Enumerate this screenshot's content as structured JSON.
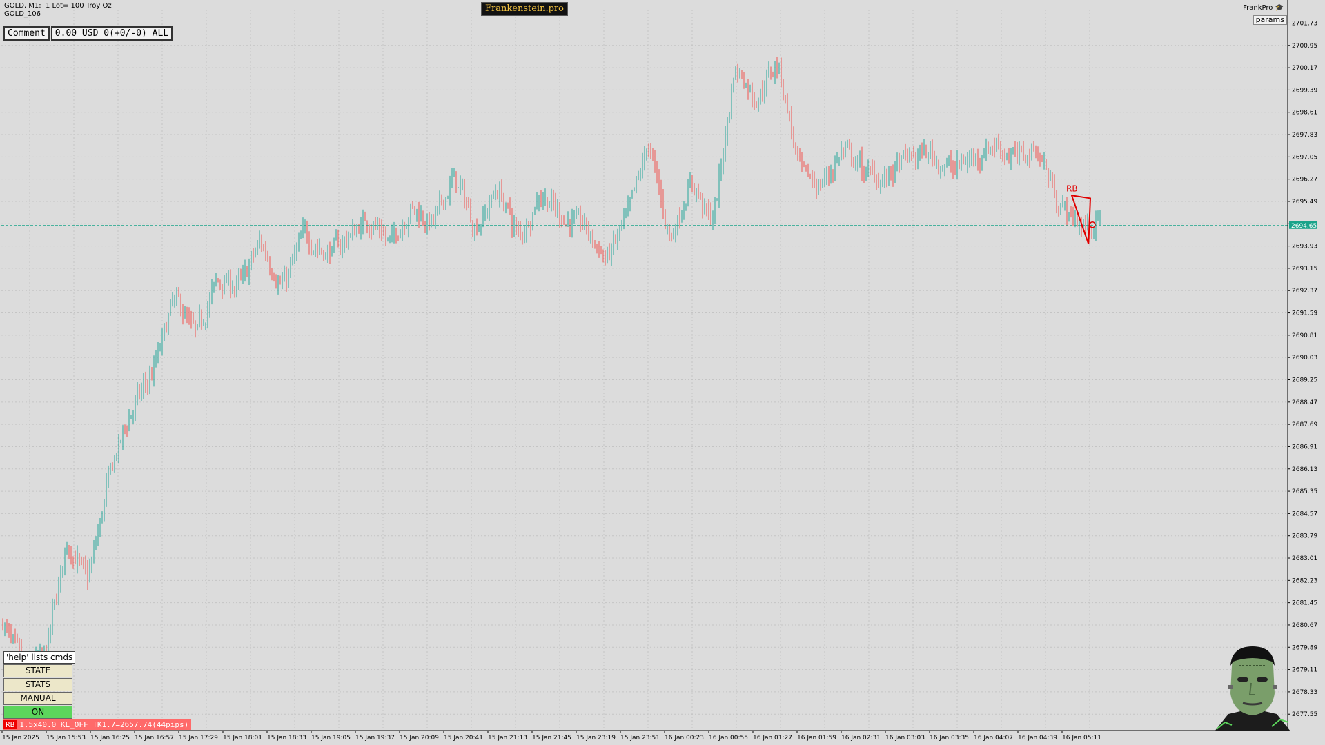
{
  "header": {
    "symbol_line": "GOLD, M1:  1 Lot= 100 Troy Oz",
    "account": "GOLD_106",
    "brand": "Frankenstein.pro",
    "right_title": "FrankPro",
    "params_label": "params"
  },
  "comment": {
    "label": "Comment",
    "value": "0.00 USD 0(+0/-0) ALL"
  },
  "controls": {
    "help": "'help' lists cmds",
    "state": "STATE",
    "stats": "STATS",
    "manual": "MANUAL",
    "on": "ON"
  },
  "status_bar": {
    "tag": "RB",
    "text": "1.5x40.0 KL_OFF TK1.7=2657.74(44pips)"
  },
  "colors": {
    "bull": "#26a69a",
    "bear": "#ef5350",
    "background": "#dcdcdc",
    "accent": "#e00000"
  },
  "chart_data": {
    "type": "candlestick",
    "ylim": [
      2677.0,
      2702.2
    ],
    "yticks": [
      "2701.73",
      "2700.95",
      "2700.17",
      "2699.39",
      "2698.61",
      "2697.83",
      "2697.05",
      "2696.27",
      "2695.49",
      "2694.71",
      "2693.93",
      "2693.15",
      "2692.37",
      "2691.59",
      "2690.81",
      "2690.03",
      "2689.25",
      "2688.47",
      "2687.69",
      "2686.91",
      "2686.13",
      "2685.35",
      "2684.57",
      "2683.79",
      "2683.01",
      "2682.23",
      "2681.45",
      "2680.67",
      "2679.89",
      "2679.11",
      "2678.33",
      "2677.55"
    ],
    "xticks": [
      "15 Jan 2025",
      "15 Jan 15:53",
      "15 Jan 16:25",
      "15 Jan 16:57",
      "15 Jan 17:29",
      "15 Jan 18:01",
      "15 Jan 18:33",
      "15 Jan 19:05",
      "15 Jan 19:37",
      "15 Jan 20:09",
      "15 Jan 20:41",
      "15 Jan 21:13",
      "15 Jan 21:45",
      "15 Jan 23:19",
      "15 Jan 23:51",
      "16 Jan 00:23",
      "16 Jan 00:55",
      "16 Jan 01:27",
      "16 Jan 01:59",
      "16 Jan 02:31",
      "16 Jan 03:03",
      "16 Jan 03:35",
      "16 Jan 04:07",
      "16 Jan 04:39",
      "16 Jan 05:11"
    ],
    "current_price": 2694.65,
    "current_price_label": "2694.65",
    "anchors": [
      2680.8,
      2679.2,
      2679.6,
      2683.6,
      2682.2,
      2686.0,
      2688.2,
      2689.5,
      2692.2,
      2690.8,
      2692.8,
      2692.5,
      2694.1,
      2692.4,
      2694.4,
      2693.6,
      2694.2,
      2694.9,
      2694.0,
      2695.3,
      2694.7,
      2696.4,
      2694.5,
      2696.0,
      2694.2,
      2695.8,
      2694.9,
      2694.7,
      2693.4,
      2694.9,
      2697.6,
      2694.1,
      2696.2,
      2694.7,
      2700.3,
      2699.0,
      2700.5,
      2696.5,
      2696.0,
      2697.3,
      2696.5,
      2696.3,
      2697.0,
      2697.2,
      2696.6,
      2697.0,
      2697.5,
      2697.0,
      2697.4,
      2695.5,
      2694.6,
      2694.8
    ],
    "annotation": {
      "label": "RB",
      "triangle": [
        [
          2025,
          2695.7
        ],
        [
          2045,
          2695.6
        ],
        [
          2043,
          2694.0
        ]
      ]
    }
  }
}
